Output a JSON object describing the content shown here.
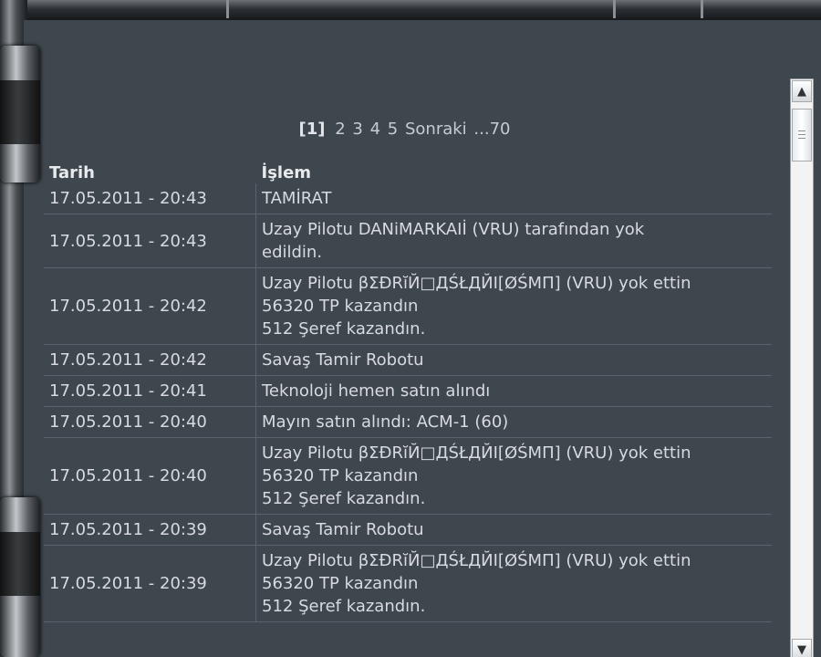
{
  "pagination": {
    "current": "[1]",
    "pages": [
      "2",
      "3",
      "4",
      "5"
    ],
    "next": "Sonraki",
    "last": "...70"
  },
  "table": {
    "headers": {
      "date": "Tarih",
      "action": "İşlem"
    },
    "rows": [
      {
        "date": "17.05.2011 - 20:43",
        "lines": [
          "TAMİRAT"
        ]
      },
      {
        "date": "17.05.2011 - 20:43",
        "lines": [
          "Uzay Pilotu DANiMARKAIİ (VRU) tarafından yok",
          "edildin."
        ]
      },
      {
        "date": "17.05.2011 - 20:42",
        "lines": [
          "Uzay Pilotu βΣÐRĭЙ□ДŚŁДЙI[ØŚMΠ] (VRU) yok ettin",
          "56320 TP kazandın",
          "512 Şeref kazandın."
        ]
      },
      {
        "date": "17.05.2011 - 20:42",
        "lines": [
          "Savaş Tamir Robotu"
        ]
      },
      {
        "date": "17.05.2011 - 20:41",
        "lines": [
          "Teknoloji hemen satın alındı"
        ]
      },
      {
        "date": "17.05.2011 - 20:40",
        "lines": [
          "Mayın satın alındı: ACM-1 (60)"
        ]
      },
      {
        "date": "17.05.2011 - 20:40",
        "lines": [
          "Uzay Pilotu βΣÐRĭЙ□ДŚŁДЙI[ØŚMΠ] (VRU) yok ettin",
          "56320 TP kazandın",
          "512 Şeref kazandın."
        ]
      },
      {
        "date": "17.05.2011 - 20:39",
        "lines": [
          "Savaş Tamir Robotu"
        ]
      },
      {
        "date": "17.05.2011 - 20:39",
        "lines": [
          "Uzay Pilotu βΣÐRĭЙ□ДŚŁДЙI[ØŚMΠ] (VRU) yok ettin",
          "56320 TP kazandın",
          "512 Şeref kazandın."
        ]
      }
    ]
  },
  "scrollbar": {
    "up_icon": "chevron-up-icon",
    "down_icon": "chevron-down-icon"
  }
}
